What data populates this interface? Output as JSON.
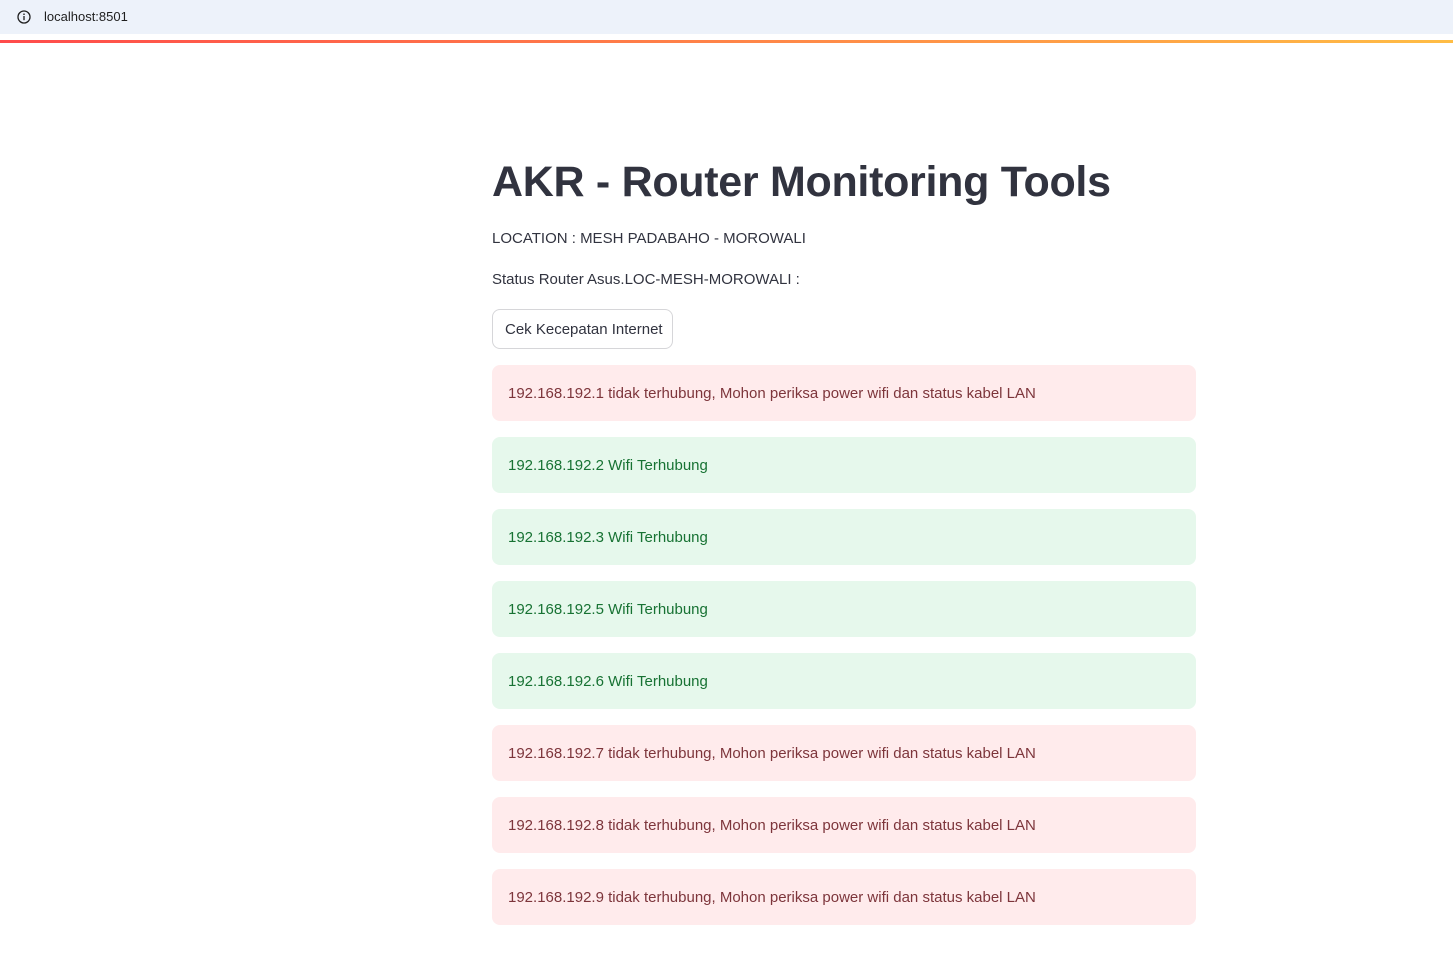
{
  "browser": {
    "url": "localhost:8501"
  },
  "page": {
    "title": "AKR - Router Monitoring Tools",
    "location": "LOCATION : MESH PADABAHO - MOROWALI",
    "status_line": "Status Router Asus.LOC-MESH-MOROWALI :",
    "speed_button_label": "Cek Kecepatan Internet"
  },
  "alerts": [
    {
      "type": "error",
      "text": "192.168.192.1 tidak terhubung, Mohon periksa power wifi dan status kabel LAN"
    },
    {
      "type": "success",
      "text": "192.168.192.2 Wifi Terhubung"
    },
    {
      "type": "success",
      "text": "192.168.192.3 Wifi Terhubung"
    },
    {
      "type": "success",
      "text": "192.168.192.5 Wifi Terhubung"
    },
    {
      "type": "success",
      "text": "192.168.192.6 Wifi Terhubung"
    },
    {
      "type": "error",
      "text": "192.168.192.7 tidak terhubung, Mohon periksa power wifi dan status kabel LAN"
    },
    {
      "type": "error",
      "text": "192.168.192.8 tidak terhubung, Mohon periksa power wifi dan status kabel LAN"
    },
    {
      "type": "error",
      "text": "192.168.192.9 tidak terhubung, Mohon periksa power wifi dan status kabel LAN"
    }
  ],
  "colors": {
    "error_bg": "#ffebec",
    "error_text": "#7d353b",
    "success_bg": "#e6f8ec",
    "success_text": "#177233",
    "accent_gradient_start": "#ff4b4b",
    "accent_gradient_end": "#ffbd45"
  }
}
